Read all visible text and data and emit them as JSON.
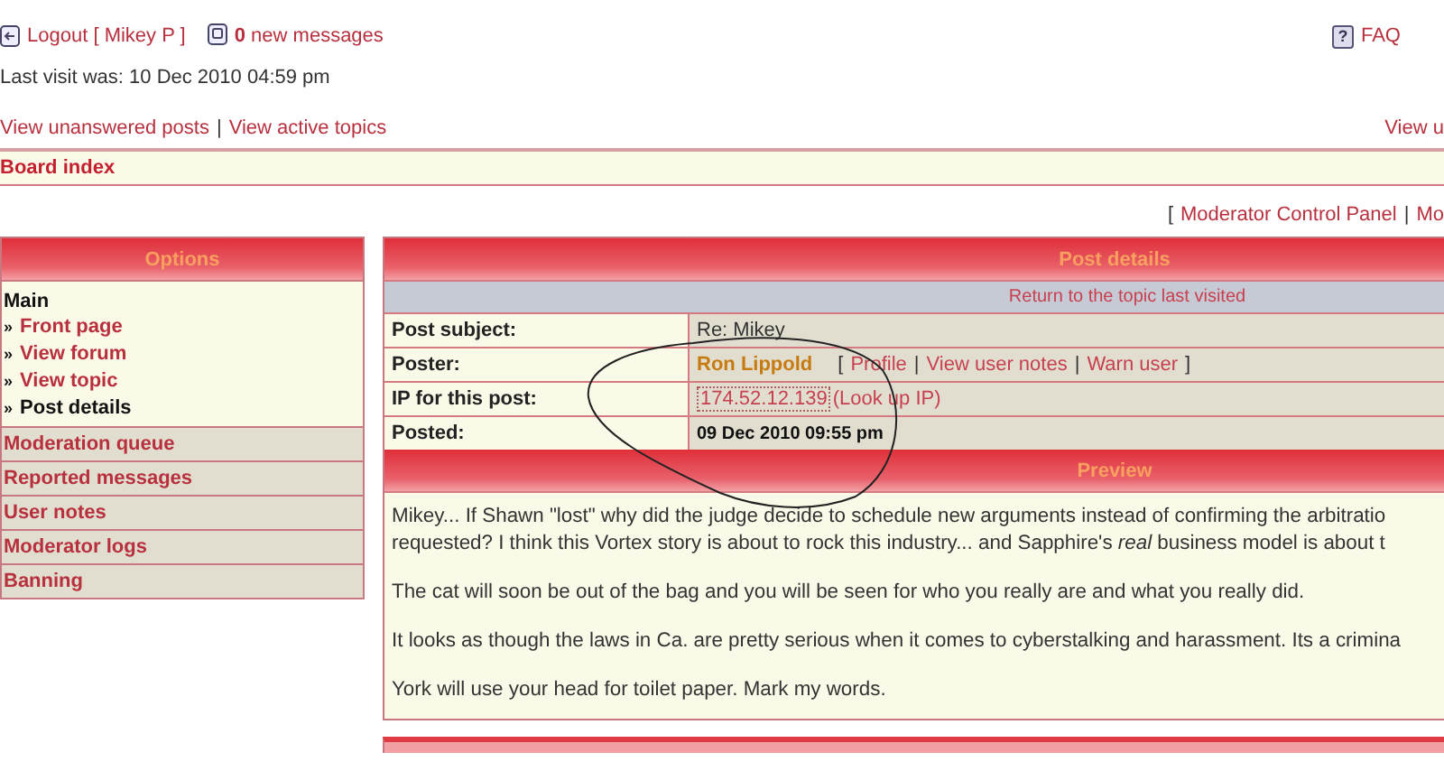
{
  "header": {
    "logout": "Logout [ Mikey P ]",
    "message_count": "0",
    "messages_label": "new messages",
    "faq_icon": "?",
    "faq": "FAQ"
  },
  "last_visit": "Last visit was: 10 Dec 2010 04:59 pm",
  "nav_links": [
    "View unanswered posts",
    "View active topics"
  ],
  "nav_right": "View u",
  "separator": "|",
  "breadcrumb": "Board index",
  "mcp_links": {
    "open_bracket": "[",
    "items": [
      "Moderator Control Panel",
      "Mo"
    ]
  },
  "sidebar": {
    "title": "Options",
    "bullet": "»",
    "sections": [
      {
        "label": "Main",
        "expanded": true,
        "items": [
          {
            "label": "Front page",
            "selected": false
          },
          {
            "label": "View forum",
            "selected": false
          },
          {
            "label": "View topic",
            "selected": false
          },
          {
            "label": "Post details",
            "selected": true
          }
        ]
      },
      {
        "label": "Moderation queue",
        "expanded": false
      },
      {
        "label": "Reported messages",
        "expanded": false
      },
      {
        "label": "User notes",
        "expanded": false
      },
      {
        "label": "Moderator logs",
        "expanded": false
      },
      {
        "label": "Banning",
        "expanded": false
      }
    ]
  },
  "post_details": {
    "title": "Post details",
    "return_link": "Return to the topic last visited",
    "rows": [
      {
        "kind": "text",
        "label": "Post subject:",
        "value": "Re: Mikey"
      },
      {
        "kind": "poster",
        "label": "Poster:",
        "name": "Ron Lippold",
        "open_bracket": "[",
        "links": [
          "Profile",
          "View user notes",
          "Warn user"
        ],
        "close_bracket": "]"
      },
      {
        "kind": "ip",
        "label": "IP for this post:",
        "ip": "174.52.12.139",
        "lookup": "(Look up IP)"
      },
      {
        "kind": "date",
        "label": "Posted:",
        "value": "09 Dec 2010 09:55 pm"
      }
    ]
  },
  "preview": {
    "title": "Preview",
    "paragraphs": [
      [
        "Mikey... If Shawn \"lost\" why did the judge decide to schedule new arguments instead of confirming the arbitratio",
        "requested? I think this Vortex story is about to rock this industry... and Sapphire's *real* business model is about t"
      ],
      [
        "The cat will soon be out of the bag and you will be seen for who you really are and what you really did."
      ],
      [
        "It looks as though the laws in Ca. are pretty serious when it comes to cyberstalking and harassment. Its a crimina"
      ],
      [
        "York will use your head for toilet paper. Mark my words."
      ]
    ]
  }
}
